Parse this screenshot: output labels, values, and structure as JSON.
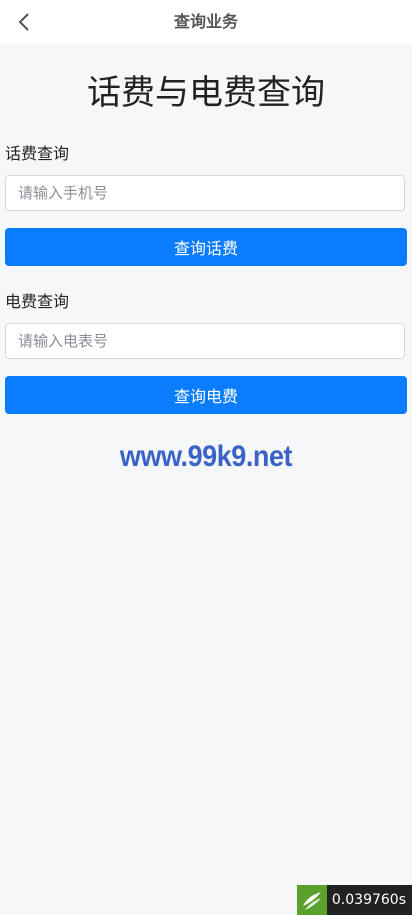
{
  "navbar": {
    "back_icon": "chevron-left-icon",
    "title": "查询业务"
  },
  "main": {
    "heading": "话费与电费查询",
    "phone_section": {
      "label": "话费查询",
      "input_placeholder": "请输入手机号",
      "input_value": "",
      "button_label": "查询话费"
    },
    "electric_section": {
      "label": "电费查询",
      "input_placeholder": "请输入电表号",
      "input_value": "",
      "button_label": "查询电费"
    },
    "watermark": "www.99k9.net"
  },
  "debug_badge": {
    "icon": "thinkphp-logo-icon",
    "time": "0.039760s"
  },
  "colors": {
    "accent": "#0a7cff",
    "watermark": "#3a63c8",
    "background": "#f6f7f9"
  }
}
